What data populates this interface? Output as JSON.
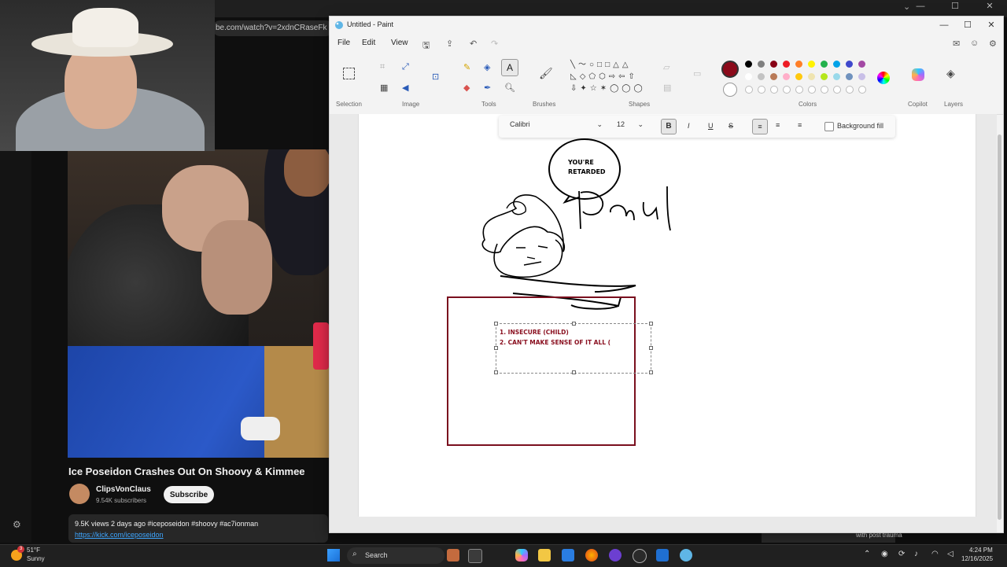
{
  "browser": {
    "url_fragment": "be.com/watch?v=2xdnCRaseFk",
    "video": {
      "title": "Ice Poseidon Crashes Out On Shoovy & Kimmee",
      "channel": "ClipsVonClaus",
      "subscribers": "9.54K subscribers",
      "subscribe_label": "Subscribe",
      "meta": "9.5K views  2 days ago  #iceposeidon #shoovy #ac7ionman",
      "link": "https://kick.com/iceposeidon"
    },
    "side_text": "with post trauma"
  },
  "paint": {
    "title": "Untitled - Paint",
    "menu": [
      "File",
      "Edit",
      "View"
    ],
    "groups": {
      "selection": "Selection",
      "image": "Image",
      "tools": "Tools",
      "brushes": "Brushes",
      "shapes": "Shapes",
      "colors": "Colors",
      "copilot": "Copilot",
      "layers": "Layers"
    },
    "text_toolbar": {
      "font": "Calibri",
      "size": "12",
      "background_fill_label": "Background fill"
    },
    "active_color": "#8b0a1a",
    "palette_row1": [
      "#000000",
      "#7f7f7f",
      "#880015",
      "#ed1c24",
      "#ff7f27",
      "#fff200",
      "#22b14c",
      "#00a2e8",
      "#3f48cc",
      "#a349a4"
    ],
    "palette_row2": [
      "#ffffff",
      "#c3c3c3",
      "#b97a57",
      "#ffaec9",
      "#ffc90e",
      "#efe4b0",
      "#b5e61d",
      "#99d9ea",
      "#7092be",
      "#c8bfe7"
    ],
    "canvas": {
      "speech_bubble_line1": "YOU'RE",
      "speech_bubble_line2": "RETARDED",
      "handwriting": "Paul",
      "list_line1": "1. INSECURE (CHILD)",
      "list_line2": "2. CAN'T MAKE SENSE OF IT ALL (",
      "box_color": "#7a0f1e"
    }
  },
  "taskbar": {
    "temperature": "51°F",
    "condition": "Sunny",
    "notification_count": "3",
    "search_label": "Search",
    "time": "4:24 PM",
    "date": "12/16/2025"
  }
}
